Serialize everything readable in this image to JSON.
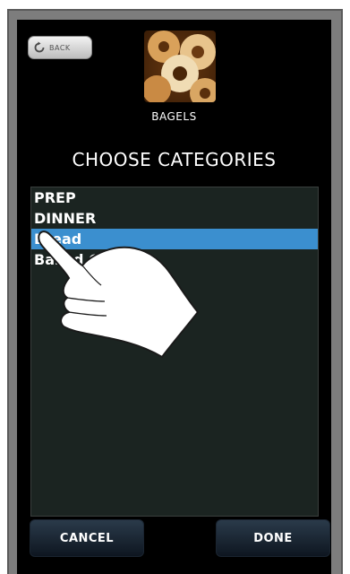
{
  "header": {
    "back_label": "BACK",
    "item_title": "BAGELS"
  },
  "main": {
    "heading": "CHOOSE CATEGORIES",
    "categories": [
      {
        "label": "PREP",
        "selected": false
      },
      {
        "label": "DINNER",
        "selected": false
      },
      {
        "label": "Bread",
        "selected": true
      },
      {
        "label": "Baked Goods",
        "selected": false
      }
    ]
  },
  "footer": {
    "cancel_label": "CANCEL",
    "done_label": "DONE"
  },
  "colors": {
    "screen_bg": "#000000",
    "list_bg": "#1b2421",
    "selection": "#3b8fcf",
    "bezel": "#7d7d7d"
  },
  "icons": {
    "back": "refresh-arrow-icon",
    "thumbnail": "bagels-photo",
    "overlay": "pointing-hand-icon"
  }
}
